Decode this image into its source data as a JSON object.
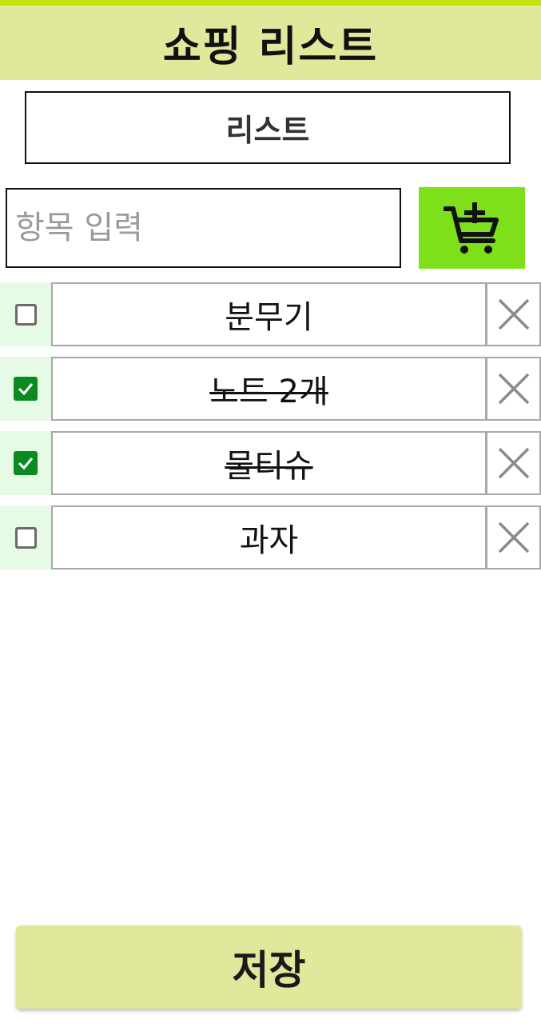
{
  "header": {
    "title": "쇼핑 리스트"
  },
  "list_name": "리스트",
  "input": {
    "placeholder": "항목 입력",
    "value": ""
  },
  "add_button": {
    "icon": "cart-plus-icon"
  },
  "items": [
    {
      "label": "분무기",
      "checked": false
    },
    {
      "label": "노트 2개",
      "checked": true
    },
    {
      "label": "물티슈",
      "checked": true
    },
    {
      "label": "과자",
      "checked": false
    }
  ],
  "save_button": {
    "label": "저장"
  },
  "colors": {
    "header_bg": "#e1e79b",
    "top_strip": "#c6e20a",
    "add_button_bg": "#7ee01a",
    "checkbox_checked": "#0a8a1f",
    "check_cell_bg": "#e6fbe6"
  }
}
